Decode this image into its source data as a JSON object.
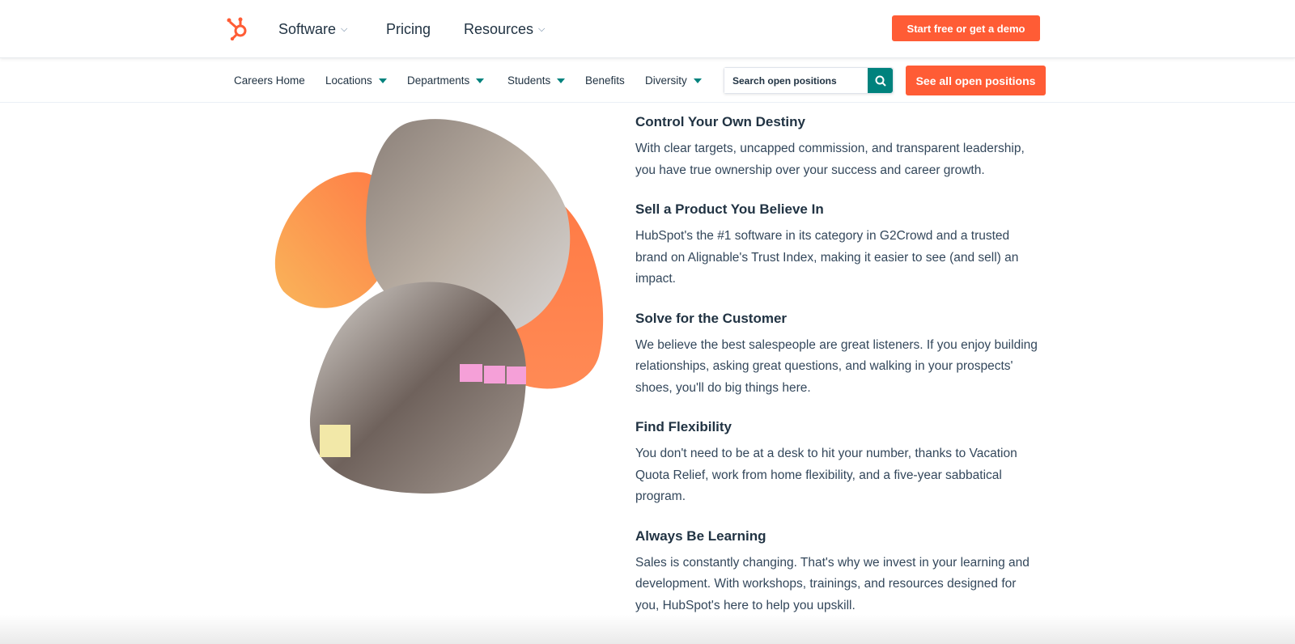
{
  "header": {
    "logo": "hubspot-logo",
    "nav": [
      {
        "label": "Software",
        "dropdown": true
      },
      {
        "label": "Pricing",
        "dropdown": false
      },
      {
        "label": "Resources",
        "dropdown": true
      }
    ],
    "cta": "Start free or get a demo"
  },
  "subnav": {
    "items": [
      {
        "label": "Careers Home",
        "dropdown": false
      },
      {
        "label": "Locations",
        "dropdown": true
      },
      {
        "label": "Departments",
        "dropdown": true
      },
      {
        "label": "Students",
        "dropdown": true
      },
      {
        "label": "Benefits",
        "dropdown": false
      },
      {
        "label": "Diversity",
        "dropdown": true
      }
    ],
    "search_placeholder": "Search open positions",
    "see_all": "See all open positions"
  },
  "colors": {
    "accent": "#ff5c35",
    "teal": "#00827d",
    "text": "#33475b"
  },
  "sections": [
    {
      "title": "Control Your Own Destiny",
      "body": "With clear targets, uncapped commission, and transparent leadership, you have true ownership over your success and career growth."
    },
    {
      "title": "Sell a Product You Believe In",
      "body": "HubSpot's the #1 software in its category in G2Crowd and a trusted brand on Alignable's Trust Index, making it easier to see (and sell) an impact."
    },
    {
      "title": "Solve for the Customer",
      "body": "We believe the best salespeople are great listeners. If you enjoy building relationships, asking great questions, and walking in your prospects' shoes, you'll do big things here."
    },
    {
      "title": "Find Flexibility",
      "body": "You don't need to be at a desk to hit your number, thanks to Vacation Quota Relief, work from home flexibility, and a five-year sabbatical program."
    },
    {
      "title": "Always Be Learning",
      "body": "Sales is constantly changing. That's why we invest in your learning and development. With workshops, trainings, and resources designed for you, HubSpot's here to help you upskill."
    }
  ]
}
